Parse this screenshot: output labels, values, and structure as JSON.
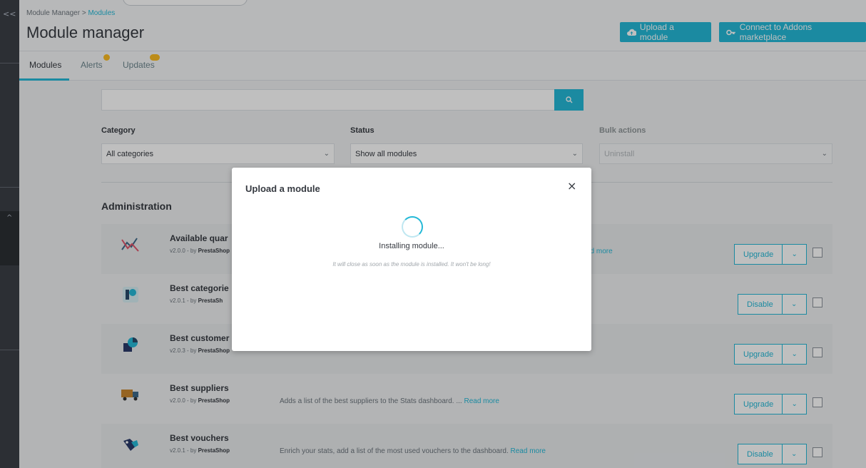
{
  "nav": {
    "collapse_glyph": "<<",
    "active_glyph": "^"
  },
  "header": {
    "breadcrumb_parent": "Module Manager",
    "breadcrumb_sep": ">",
    "breadcrumb_current": "Modules",
    "title": "Module manager",
    "upload_label": "Upload a module",
    "addons_label": "Connect to Addons marketplace"
  },
  "tabs": {
    "modules": "Modules",
    "alerts": "Alerts",
    "updates": "Updates"
  },
  "filters": {
    "category_label": "Category",
    "category_value": "All categories",
    "status_label": "Status",
    "status_value": "Show all modules",
    "bulk_label": "Bulk actions",
    "bulk_value": "Uninstall"
  },
  "section": {
    "title": "Administration"
  },
  "modules": [
    {
      "name": "Available quar",
      "version": "v2.0.0 - by ",
      "author": "PrestaShop",
      "description": "",
      "read_more": "ad more",
      "action": "Upgrade"
    },
    {
      "name": "Best categorie",
      "version": "v2.0.1 - by ",
      "author": "PrestaSh",
      "description": "",
      "read_more": "",
      "action": "Disable"
    },
    {
      "name": "Best customer",
      "version": "v2.0.3 - by ",
      "author": "PrestaShop",
      "description": "",
      "read_more": "",
      "action": "Upgrade"
    },
    {
      "name": "Best suppliers",
      "version": "v2.0.0 - by ",
      "author": "PrestaShop",
      "description": "Adds a list of the best suppliers to the Stats dashboard. ...",
      "read_more": "Read more",
      "action": "Upgrade"
    },
    {
      "name": "Best vouchers",
      "version": "v2.0.1 - by ",
      "author": "PrestaShop",
      "description": "Enrich your stats, add a list of the most used vouchers to the dashboard.",
      "read_more": "Read more",
      "action": "Disable"
    }
  ],
  "modal": {
    "title": "Upload a module",
    "close": "×",
    "status": "Installing module...",
    "hint": "It will close as soon as the module is installed. It won't be long!"
  },
  "colors": {
    "accent": "#25b9d7",
    "badge": "#fbbb22",
    "rail": "#2c2f34"
  }
}
